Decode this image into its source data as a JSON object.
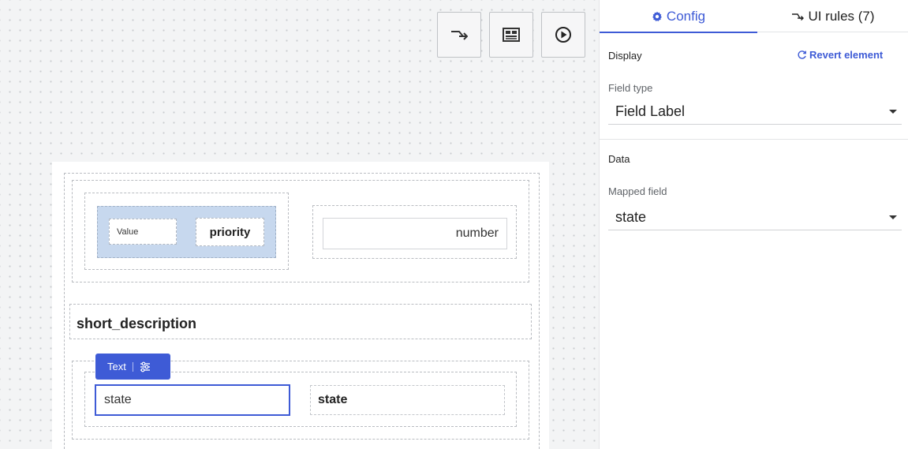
{
  "toolbar": {
    "rules_icon": "branch-rules-icon",
    "layout_icon": "form-layout-icon",
    "preview_icon": "play-circle-icon"
  },
  "form": {
    "value_chip": "Value",
    "priority_label": "priority",
    "number_field": "number",
    "short_description_label": "short_description",
    "text_chip_label": "Text",
    "text_chip_icon": "sliders-icon",
    "state_input_value": "state",
    "state_label": "state"
  },
  "panel": {
    "tabs": [
      {
        "label": "Config",
        "icon": "gear-icon",
        "active": true
      },
      {
        "label": "UI rules (7)",
        "icon": "branch-rules-icon",
        "active": false
      }
    ],
    "display_section": "Display",
    "revert_label": "Revert element",
    "field_type_caption": "Field type",
    "field_type_value": "Field Label",
    "data_section": "Data",
    "mapped_field_caption": "Mapped field",
    "mapped_field_value": "state"
  },
  "colors": {
    "accent": "#3e5bd6",
    "group_highlight": "#c7d8ee",
    "canvas_bg": "#f3f4f5"
  }
}
